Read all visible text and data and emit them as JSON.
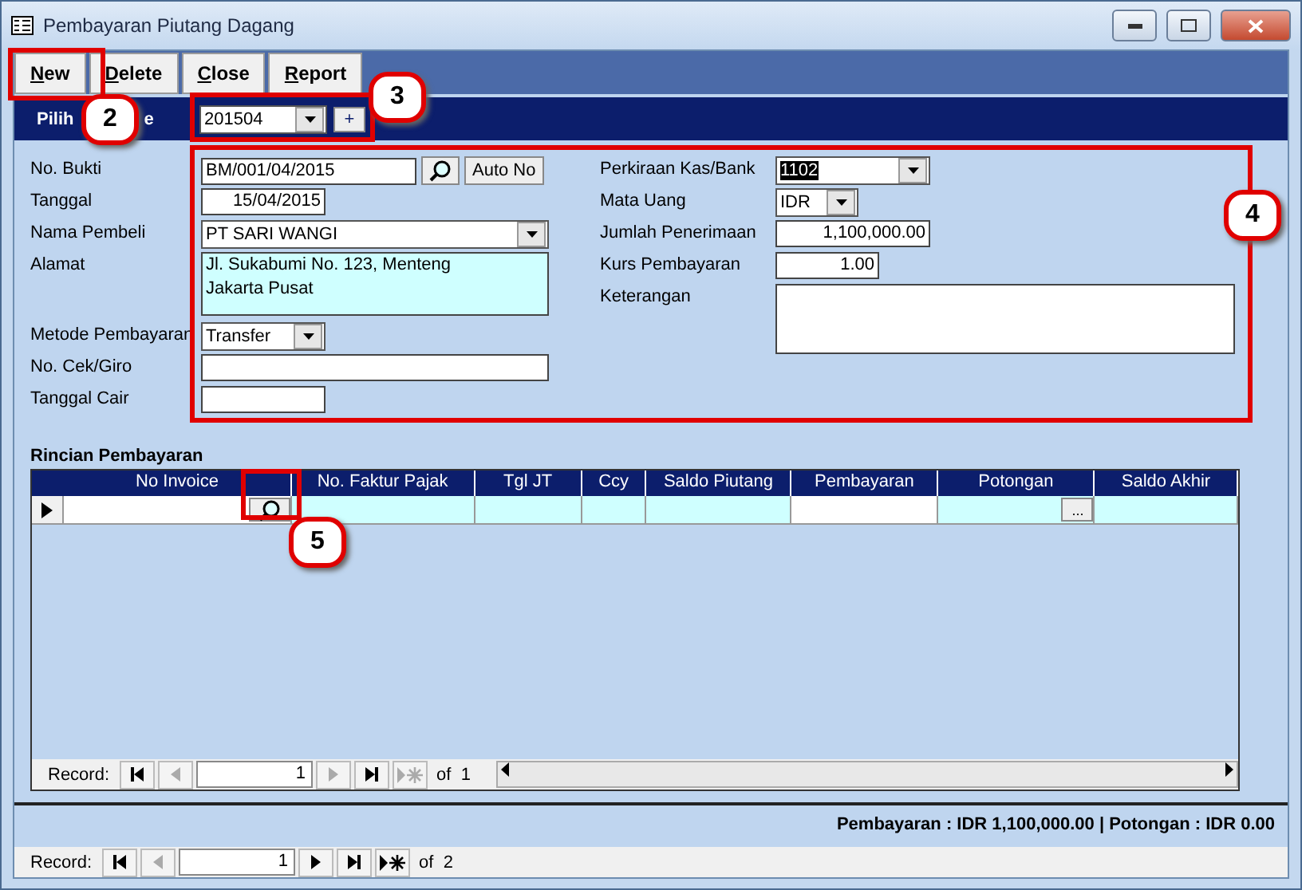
{
  "window": {
    "title": "Pembayaran Piutang Dagang"
  },
  "toolbar": {
    "buttons": [
      {
        "label": "New"
      },
      {
        "label": "Delete"
      },
      {
        "label": "Close"
      },
      {
        "label": "Report"
      }
    ]
  },
  "period": {
    "label_start": "Pilih",
    "label_end": "e",
    "value": "201504",
    "add_button": "+"
  },
  "fields_left": [
    {
      "label": "No. Bukti",
      "kind": "search",
      "value": "BM/001/04/2015",
      "button": "Auto No"
    },
    {
      "label": "Tanggal",
      "kind": "date",
      "value": "15/04/2015"
    },
    {
      "label": "Nama Pembeli",
      "kind": "dropdown",
      "value": "PT SARI WANGI"
    },
    {
      "label": "Alamat",
      "kind": "memo",
      "lines": [
        "Jl. Sukabumi No. 123, Menteng",
        "Jakarta Pusat"
      ]
    },
    {
      "label": "Metode Pembayaran",
      "kind": "dropdown",
      "value": "Transfer"
    },
    {
      "label": "No. Cek/Giro",
      "kind": "text"
    },
    {
      "label": "Tanggal Cair",
      "kind": "text"
    }
  ],
  "fields_right": [
    {
      "label": "Perkiraan Kas/Bank",
      "kind": "dropdown",
      "value": "1102",
      "highlighted": true
    },
    {
      "label": "Mata Uang",
      "kind": "dropdown",
      "value": "IDR",
      "highlighted": false
    },
    {
      "label": "Jumlah Penerimaan",
      "kind": "number",
      "value": "1,100,000.00"
    },
    {
      "label": "Kurs Pembayaran",
      "kind": "number",
      "value": "1.00"
    },
    {
      "label": "Keterangan",
      "kind": "memo"
    }
  ],
  "detail": {
    "title": "Rincian Pembayaran",
    "columns": [
      {
        "label": "No Invoice",
        "editable": true
      },
      {
        "label": "No. Faktur Pajak",
        "editable": false
      },
      {
        "label": "Tgl JT",
        "editable": false
      },
      {
        "label": "Ccy",
        "editable": false
      },
      {
        "label": "Saldo Piutang",
        "editable": false
      },
      {
        "label": "Pembayaran",
        "editable": true
      },
      {
        "label": "Potongan",
        "editable": false
      },
      {
        "label": "Saldo Akhir",
        "editable": false
      }
    ],
    "ellipsis_button": "...",
    "navigator": {
      "label": "Record:",
      "current": "1",
      "total": "of  1"
    }
  },
  "summary": "Pembayaran : IDR 1,100,000.00 | Potongan : IDR 0.00",
  "navigator": {
    "label": "Record:",
    "current": "1",
    "total": "of  2"
  },
  "callouts": [
    {
      "number": "2"
    },
    {
      "number": "3"
    },
    {
      "number": "4"
    },
    {
      "number": "5"
    }
  ]
}
